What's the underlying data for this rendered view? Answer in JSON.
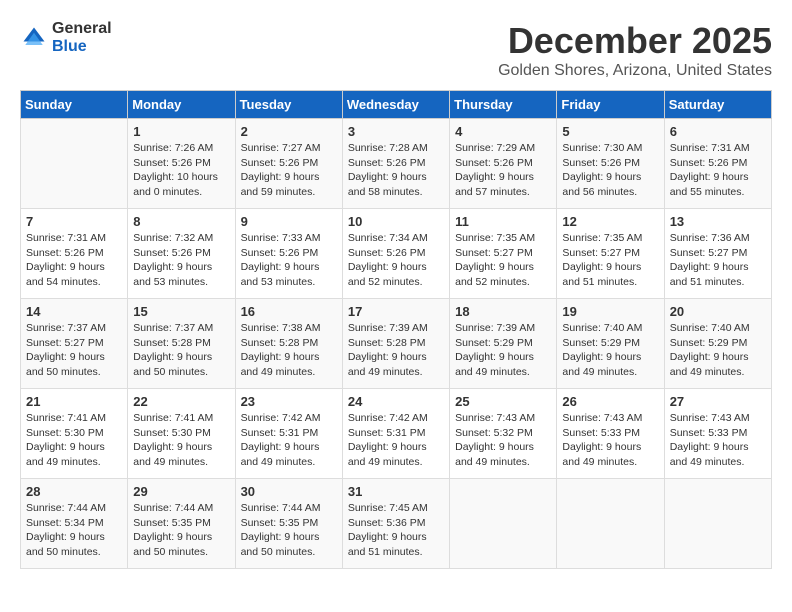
{
  "header": {
    "logo_general": "General",
    "logo_blue": "Blue",
    "month": "December 2025",
    "location": "Golden Shores, Arizona, United States"
  },
  "days_of_week": [
    "Sunday",
    "Monday",
    "Tuesday",
    "Wednesday",
    "Thursday",
    "Friday",
    "Saturday"
  ],
  "weeks": [
    [
      {
        "day": "",
        "info": ""
      },
      {
        "day": "1",
        "info": "Sunrise: 7:26 AM\nSunset: 5:26 PM\nDaylight: 10 hours\nand 0 minutes."
      },
      {
        "day": "2",
        "info": "Sunrise: 7:27 AM\nSunset: 5:26 PM\nDaylight: 9 hours\nand 59 minutes."
      },
      {
        "day": "3",
        "info": "Sunrise: 7:28 AM\nSunset: 5:26 PM\nDaylight: 9 hours\nand 58 minutes."
      },
      {
        "day": "4",
        "info": "Sunrise: 7:29 AM\nSunset: 5:26 PM\nDaylight: 9 hours\nand 57 minutes."
      },
      {
        "day": "5",
        "info": "Sunrise: 7:30 AM\nSunset: 5:26 PM\nDaylight: 9 hours\nand 56 minutes."
      },
      {
        "day": "6",
        "info": "Sunrise: 7:31 AM\nSunset: 5:26 PM\nDaylight: 9 hours\nand 55 minutes."
      }
    ],
    [
      {
        "day": "7",
        "info": "Sunrise: 7:31 AM\nSunset: 5:26 PM\nDaylight: 9 hours\nand 54 minutes."
      },
      {
        "day": "8",
        "info": "Sunrise: 7:32 AM\nSunset: 5:26 PM\nDaylight: 9 hours\nand 53 minutes."
      },
      {
        "day": "9",
        "info": "Sunrise: 7:33 AM\nSunset: 5:26 PM\nDaylight: 9 hours\nand 53 minutes."
      },
      {
        "day": "10",
        "info": "Sunrise: 7:34 AM\nSunset: 5:26 PM\nDaylight: 9 hours\nand 52 minutes."
      },
      {
        "day": "11",
        "info": "Sunrise: 7:35 AM\nSunset: 5:27 PM\nDaylight: 9 hours\nand 52 minutes."
      },
      {
        "day": "12",
        "info": "Sunrise: 7:35 AM\nSunset: 5:27 PM\nDaylight: 9 hours\nand 51 minutes."
      },
      {
        "day": "13",
        "info": "Sunrise: 7:36 AM\nSunset: 5:27 PM\nDaylight: 9 hours\nand 51 minutes."
      }
    ],
    [
      {
        "day": "14",
        "info": "Sunrise: 7:37 AM\nSunset: 5:27 PM\nDaylight: 9 hours\nand 50 minutes."
      },
      {
        "day": "15",
        "info": "Sunrise: 7:37 AM\nSunset: 5:28 PM\nDaylight: 9 hours\nand 50 minutes."
      },
      {
        "day": "16",
        "info": "Sunrise: 7:38 AM\nSunset: 5:28 PM\nDaylight: 9 hours\nand 49 minutes."
      },
      {
        "day": "17",
        "info": "Sunrise: 7:39 AM\nSunset: 5:28 PM\nDaylight: 9 hours\nand 49 minutes."
      },
      {
        "day": "18",
        "info": "Sunrise: 7:39 AM\nSunset: 5:29 PM\nDaylight: 9 hours\nand 49 minutes."
      },
      {
        "day": "19",
        "info": "Sunrise: 7:40 AM\nSunset: 5:29 PM\nDaylight: 9 hours\nand 49 minutes."
      },
      {
        "day": "20",
        "info": "Sunrise: 7:40 AM\nSunset: 5:29 PM\nDaylight: 9 hours\nand 49 minutes."
      }
    ],
    [
      {
        "day": "21",
        "info": "Sunrise: 7:41 AM\nSunset: 5:30 PM\nDaylight: 9 hours\nand 49 minutes."
      },
      {
        "day": "22",
        "info": "Sunrise: 7:41 AM\nSunset: 5:30 PM\nDaylight: 9 hours\nand 49 minutes."
      },
      {
        "day": "23",
        "info": "Sunrise: 7:42 AM\nSunset: 5:31 PM\nDaylight: 9 hours\nand 49 minutes."
      },
      {
        "day": "24",
        "info": "Sunrise: 7:42 AM\nSunset: 5:31 PM\nDaylight: 9 hours\nand 49 minutes."
      },
      {
        "day": "25",
        "info": "Sunrise: 7:43 AM\nSunset: 5:32 PM\nDaylight: 9 hours\nand 49 minutes."
      },
      {
        "day": "26",
        "info": "Sunrise: 7:43 AM\nSunset: 5:33 PM\nDaylight: 9 hours\nand 49 minutes."
      },
      {
        "day": "27",
        "info": "Sunrise: 7:43 AM\nSunset: 5:33 PM\nDaylight: 9 hours\nand 49 minutes."
      }
    ],
    [
      {
        "day": "28",
        "info": "Sunrise: 7:44 AM\nSunset: 5:34 PM\nDaylight: 9 hours\nand 50 minutes."
      },
      {
        "day": "29",
        "info": "Sunrise: 7:44 AM\nSunset: 5:35 PM\nDaylight: 9 hours\nand 50 minutes."
      },
      {
        "day": "30",
        "info": "Sunrise: 7:44 AM\nSunset: 5:35 PM\nDaylight: 9 hours\nand 50 minutes."
      },
      {
        "day": "31",
        "info": "Sunrise: 7:45 AM\nSunset: 5:36 PM\nDaylight: 9 hours\nand 51 minutes."
      },
      {
        "day": "",
        "info": ""
      },
      {
        "day": "",
        "info": ""
      },
      {
        "day": "",
        "info": ""
      }
    ]
  ]
}
